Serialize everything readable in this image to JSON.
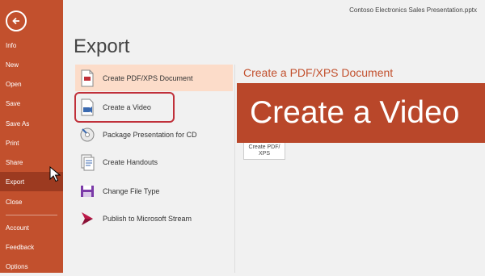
{
  "window": {
    "title": "Contoso Electronics Sales Presentation.pptx"
  },
  "sidebar": {
    "items": [
      {
        "label": "Info"
      },
      {
        "label": "New"
      },
      {
        "label": "Open"
      },
      {
        "label": "Save"
      },
      {
        "label": "Save As"
      },
      {
        "label": "Print"
      },
      {
        "label": "Share"
      },
      {
        "label": "Export"
      },
      {
        "label": "Close"
      },
      {
        "label": "Account"
      },
      {
        "label": "Feedback"
      },
      {
        "label": "Options"
      }
    ],
    "active": "Export"
  },
  "main": {
    "title": "Export",
    "options": [
      {
        "label": "Create PDF/XPS Document",
        "icon": "pdf-document-icon"
      },
      {
        "label": "Create a Video",
        "icon": "video-icon"
      },
      {
        "label": "Package Presentation for CD",
        "icon": "cd-icon"
      },
      {
        "label": "Create Handouts",
        "icon": "handouts-icon"
      },
      {
        "label": "Change File Type",
        "icon": "file-type-icon"
      },
      {
        "label": "Publish to Microsoft Stream",
        "icon": "stream-icon"
      }
    ]
  },
  "detail": {
    "title": "Create a PDF/XPS Document",
    "button_line1": "Create PDF/",
    "button_line2": "XPS"
  },
  "overlay": {
    "banner_text": "Create a Video"
  },
  "colors": {
    "accent": "#c2502d",
    "active": "#9c3a20",
    "selected": "#fcdcc9",
    "highlight": "#c0303a",
    "banner": "#b9472a"
  }
}
